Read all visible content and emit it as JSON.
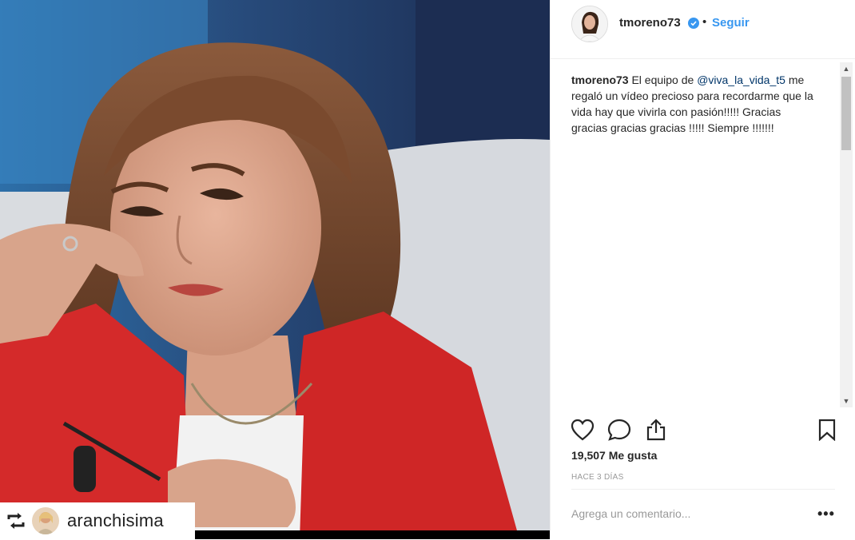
{
  "post": {
    "username": "tmoreno73",
    "separator": "•",
    "follow_label": "Seguir",
    "caption": {
      "username": "tmoreno73",
      "text_before": " El equipo de ",
      "mention": "@viva_la_vida_t5",
      "text_after": " me regaló un vídeo precioso para recordarme que la vida hay que vivirla con pasión!!!!! Gracias gracias gracias gracias !!!!! Siempre !!!!!!!"
    },
    "likes_text": "19,507 Me gusta",
    "time_text": "HACE 3 DÍAS",
    "comment_placeholder": "Agrega un comentario...",
    "more_label": "•••"
  },
  "repost": {
    "account": "aranchisima"
  },
  "icons": {
    "verified": "verified-badge-icon",
    "like": "heart-icon",
    "comment": "comment-bubble-icon",
    "share": "share-icon",
    "save": "bookmark-icon",
    "repost": "repost-icon"
  },
  "colors": {
    "link": "#3897f0",
    "mention": "#003569",
    "jacket": "#d42a2a"
  }
}
